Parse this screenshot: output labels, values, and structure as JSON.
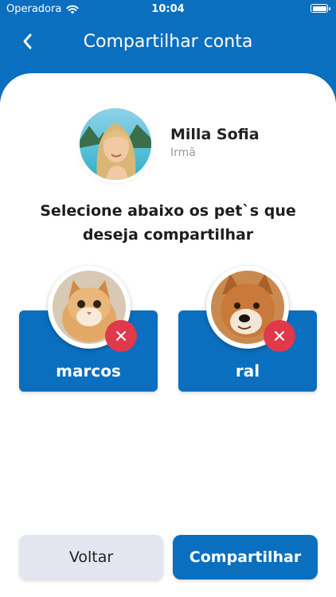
{
  "status_bar": {
    "carrier": "Operadora",
    "time": "10:04"
  },
  "header": {
    "title": "Compartilhar conta"
  },
  "profile": {
    "name": "Milla Sofia",
    "relation": "Irmã"
  },
  "instruction": {
    "line1": "Selecione abaixo os pet`s que",
    "line2": "deseja compartilhar"
  },
  "pets": [
    {
      "name": "marcos",
      "photo_icon": "cat-photo"
    },
    {
      "name": "ral",
      "photo_icon": "dog-photo"
    }
  ],
  "buttons": {
    "back_label": "Voltar",
    "share_label": "Compartilhar"
  },
  "colors": {
    "primary": "#0b6fbf",
    "remove": "#e0394b",
    "secondary_button": "#e3e6ee"
  }
}
